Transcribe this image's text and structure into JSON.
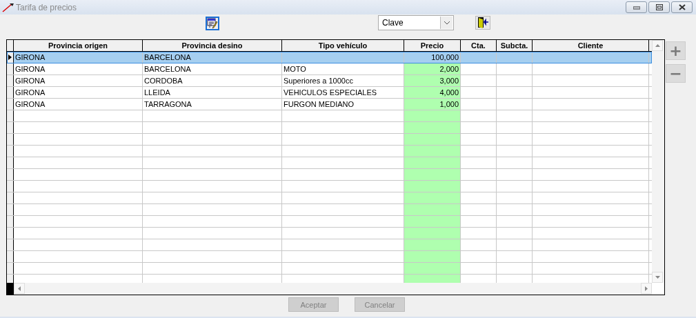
{
  "window": {
    "title": "Tarifa de precios"
  },
  "toolbar": {
    "sort_select": {
      "value": "Clave"
    }
  },
  "table": {
    "columns": [
      "Provincia origen",
      "Provincia desino",
      "Tipo vehículo",
      "Precio",
      "Cta.",
      "Subcta.",
      "Cliente"
    ],
    "rows": [
      {
        "cells": [
          "GIRONA",
          "BARCELONA",
          "",
          "100,000",
          "",
          "",
          ""
        ],
        "selected": true
      },
      {
        "cells": [
          "GIRONA",
          "BARCELONA",
          "MOTO",
          "2,000",
          "",
          "",
          ""
        ],
        "selected": false
      },
      {
        "cells": [
          "GIRONA",
          "CORDOBA",
          "Superiores a 1000cc",
          "3,000",
          "",
          "",
          ""
        ],
        "selected": false
      },
      {
        "cells": [
          "GIRONA",
          "LLEIDA",
          "VEHICULOS ESPECIALES",
          "4,000",
          "",
          "",
          ""
        ],
        "selected": false
      },
      {
        "cells": [
          "GIRONA",
          "TARRAGONA",
          "FURGON MEDIANO",
          "1,000",
          "",
          "",
          ""
        ],
        "selected": false
      }
    ]
  },
  "side_buttons": [
    {
      "label": "+",
      "disabled": true
    },
    {
      "label": "−",
      "disabled": true
    }
  ],
  "buttons": [
    {
      "label": "Aceptar",
      "disabled": true
    },
    {
      "label": "Cancelar",
      "disabled": true
    }
  ]
}
